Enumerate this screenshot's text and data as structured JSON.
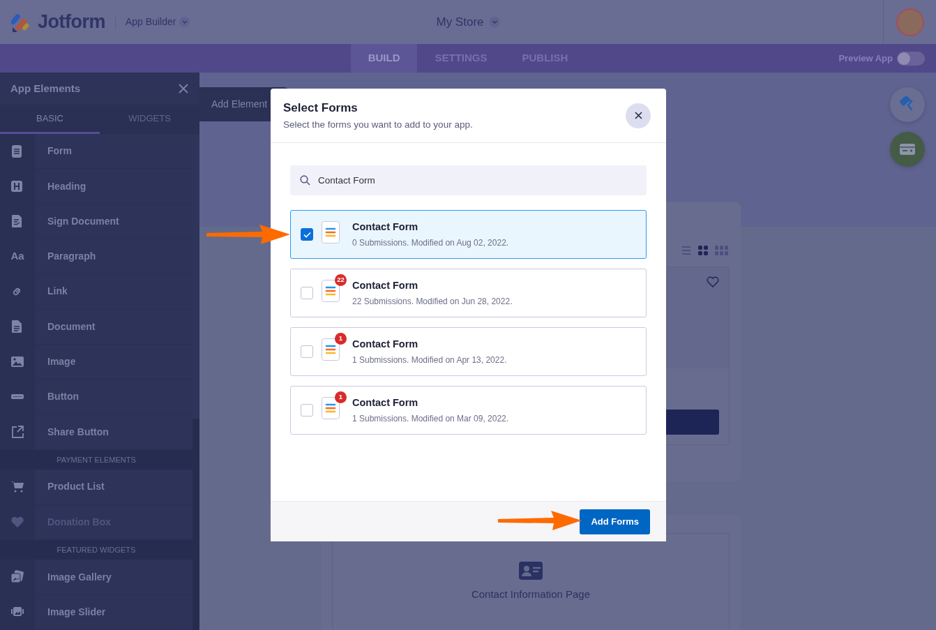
{
  "header": {
    "logo": "Jotform",
    "product": "App Builder",
    "app_name": "My Store"
  },
  "nav_tabs": [
    {
      "label": "BUILD",
      "selected": true
    },
    {
      "label": "SETTINGS",
      "selected": false
    },
    {
      "label": "PUBLISH",
      "selected": false
    }
  ],
  "preview_toggle": {
    "label": "Preview App",
    "on": false
  },
  "sidebar": {
    "title": "App Elements",
    "tabs": [
      {
        "label": "BASIC",
        "selected": true
      },
      {
        "label": "WIDGETS",
        "selected": false
      }
    ],
    "items": [
      {
        "kind": "item",
        "label": "Form",
        "disabled": false
      },
      {
        "kind": "item",
        "label": "Heading",
        "disabled": false
      },
      {
        "kind": "item",
        "label": "Sign Document",
        "disabled": false
      },
      {
        "kind": "item",
        "label": "Paragraph",
        "disabled": false,
        "icon_text": "Aa"
      },
      {
        "kind": "item",
        "label": "Link",
        "disabled": false
      },
      {
        "kind": "item",
        "label": "Document",
        "disabled": false
      },
      {
        "kind": "item",
        "label": "Image",
        "disabled": false
      },
      {
        "kind": "item",
        "label": "Button",
        "disabled": false
      },
      {
        "kind": "item",
        "label": "Share Button",
        "disabled": false
      },
      {
        "kind": "section",
        "label": "PAYMENT ELEMENTS"
      },
      {
        "kind": "item",
        "label": "Product List",
        "disabled": false
      },
      {
        "kind": "item",
        "label": "Donation Box",
        "disabled": true
      },
      {
        "kind": "section",
        "label": "FEATURED WIDGETS"
      },
      {
        "kind": "item",
        "label": "Image Gallery",
        "disabled": false
      },
      {
        "kind": "item",
        "label": "Image Slider",
        "disabled": false
      }
    ]
  },
  "add_element_tab": "Add Element",
  "background_page": {
    "section_title": "Contact Information Page"
  },
  "modal": {
    "title": "Select Forms",
    "subtitle": "Select the forms you want to add to your app.",
    "search": {
      "value": "Contact Form"
    },
    "forms": [
      {
        "name": "Contact Form",
        "details": "0 Submissions. Modified on Aug 02, 2022.",
        "selected": true
      },
      {
        "name": "Contact Form",
        "details": "22 Submissions. Modified on Jun 28, 2022.",
        "selected": false,
        "badge": "22"
      },
      {
        "name": "Contact Form",
        "details": "1 Submissions. Modified on Apr 13, 2022.",
        "selected": false,
        "badge": "1"
      },
      {
        "name": "Contact Form",
        "details": "1 Submissions. Modified on Mar 09, 2022.",
        "selected": false,
        "badge": "1"
      }
    ],
    "add_button": "Add Forms"
  }
}
